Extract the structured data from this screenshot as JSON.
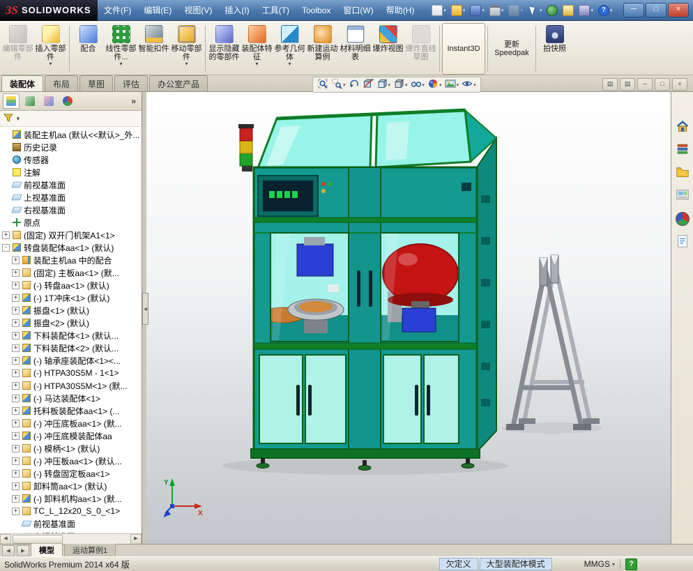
{
  "colors": {
    "status-blue": "#cfe0f2",
    "machine-teal": "#149a91",
    "machine-glass": "#a4f2ea",
    "machine-roof": "#97f4e8",
    "frame-green": "#0f7e28",
    "dome-red": "#c41414",
    "unit-blue": "#2b3fd4",
    "disc-orange": "#c87a2e",
    "stand-gray": "#868c92"
  },
  "titlebar": {
    "logo_mark": "3S",
    "logo_text": "SOLIDWORKS",
    "menus": [
      "文件(F)",
      "编辑(E)",
      "视图(V)",
      "插入(I)",
      "工具(T)",
      "Toolbox",
      "窗口(W)",
      "帮助(H)"
    ],
    "quick_icons": [
      {
        "name": "new-document",
        "dropdown": true
      },
      {
        "name": "open",
        "dropdown": true
      },
      {
        "name": "save",
        "dropdown": true
      },
      {
        "name": "print",
        "dropdown": true
      },
      {
        "name": "undo",
        "dropdown": true,
        "disabled": true
      },
      {
        "name": "select",
        "dropdown": true
      },
      {
        "name": "rebuild",
        "dropdown": false
      },
      {
        "name": "file-properties",
        "dropdown": false
      },
      {
        "name": "options",
        "dropdown": true
      },
      {
        "name": "help",
        "dropdown": true,
        "glyph": "?"
      }
    ],
    "window_controls": [
      {
        "name": "minimize",
        "glyph": "─"
      },
      {
        "name": "maximize",
        "glyph": "□"
      },
      {
        "name": "close",
        "glyph": "×"
      }
    ]
  },
  "ribbon": {
    "buttons": [
      {
        "label": "编辑零部件",
        "icon": "edit-component",
        "disabled": true
      },
      {
        "label": "插入零部件",
        "icon": "insert-components",
        "dropdown": true,
        "group_end": true
      },
      {
        "label": "配合",
        "icon": "mate"
      },
      {
        "label": "线性零部件...",
        "icon": "linear-component-pattern",
        "dropdown": true
      },
      {
        "label": "智能扣件",
        "icon": "smart-fasteners"
      },
      {
        "label": "移动零部件",
        "icon": "move-component",
        "dropdown": true,
        "group_end": true
      },
      {
        "label": "显示隐藏的零部件",
        "icon": "show-hidden-components"
      },
      {
        "label": "装配体特征",
        "icon": "assembly-features",
        "dropdown": true
      },
      {
        "label": "参考几何体",
        "icon": "reference-geometry",
        "dropdown": true
      },
      {
        "label": "新建运动算例",
        "icon": "new-motion-study"
      },
      {
        "label": "材料明细表",
        "icon": "bill-of-materials"
      },
      {
        "label": "爆炸视图",
        "icon": "exploded-view"
      },
      {
        "label": "爆炸直线草图",
        "icon": "explode-line-sketch",
        "disabled": true,
        "group_end": true
      },
      {
        "label": "Instant3D",
        "active": true,
        "group_end": true
      },
      {
        "label": "更新Speedpak",
        "group_end": true
      },
      {
        "label": "拍快照",
        "icon": "take-snapshot"
      }
    ]
  },
  "command_tabs": {
    "items": [
      "装配体",
      "布局",
      "草图",
      "评估",
      "办公室产品"
    ],
    "active_index": 0
  },
  "headsup": {
    "buttons": [
      {
        "name": "zoom-fit"
      },
      {
        "name": "zoom-area",
        "dropdown": true
      },
      {
        "name": "previous-view"
      },
      {
        "name": "section-view"
      },
      {
        "name": "view-orientation",
        "dropdown": true
      },
      {
        "name": "display-style",
        "dropdown": true
      },
      {
        "name": "hide-show-items",
        "dropdown": true
      },
      {
        "name": "edit-appearance",
        "dropdown": true
      },
      {
        "name": "apply-scene",
        "dropdown": true
      },
      {
        "name": "view-settings",
        "dropdown": true
      }
    ]
  },
  "doc_controls": [
    {
      "name": "pane-left",
      "glyph": "▤"
    },
    {
      "name": "pane-right",
      "glyph": "▤"
    },
    {
      "name": "doc-minimize",
      "glyph": "─"
    },
    {
      "name": "doc-restore",
      "glyph": "□"
    },
    {
      "name": "doc-close",
      "glyph": "×"
    }
  ],
  "feature_panel": {
    "tabs": [
      {
        "name": "featuremanager-tree"
      },
      {
        "name": "propertymanager"
      },
      {
        "name": "configurationmanager"
      },
      {
        "name": "displaymanager"
      }
    ],
    "overflow_glyph": "»",
    "filter_dropdown_glyph": "▼",
    "collapse_glyph": "◀",
    "scrollbar": {
      "left_glyph": "◀",
      "right_glyph": "▶"
    },
    "items": [
      {
        "label": "装配主机aa (默认<<默认>_外...",
        "icon": "assembly-top",
        "indent": 0
      },
      {
        "label": "历史记录",
        "icon": "history-folder",
        "indent": 0
      },
      {
        "label": "传感器",
        "icon": "sensors-folder",
        "indent": 0
      },
      {
        "label": "注解",
        "icon": "annotations-folder",
        "indent": 0
      },
      {
        "label": "前视基准面",
        "icon": "plane",
        "indent": 0
      },
      {
        "label": "上视基准面",
        "icon": "plane",
        "indent": 0
      },
      {
        "label": "右视基准面",
        "icon": "plane",
        "indent": 0
      },
      {
        "label": "原点",
        "icon": "origin",
        "indent": 0
      },
      {
        "label": "(固定) 双开门机架A1<1>",
        "icon": "part",
        "indent": 0,
        "expand": "plus"
      },
      {
        "label": "转盘装配体aa<1> (默认)",
        "icon": "assembly",
        "indent": 0,
        "expand": "minus"
      },
      {
        "label": "装配主机aa 中的配合",
        "icon": "mates-folder",
        "indent": 1,
        "expand": "plus"
      },
      {
        "label": "(固定) 主板aa<1> (默...",
        "icon": "part",
        "indent": 1,
        "expand": "plus"
      },
      {
        "label": "(-) 转盘aa<1> (默认)",
        "icon": "part",
        "indent": 1,
        "expand": "plus"
      },
      {
        "label": "(-) 1T冲床<1> (默认)",
        "icon": "assembly",
        "indent": 1,
        "expand": "plus"
      },
      {
        "label": "振盘<1> (默认)",
        "icon": "assembly",
        "indent": 1,
        "expand": "plus"
      },
      {
        "label": "振盘<2> (默认)",
        "icon": "assembly",
        "indent": 1,
        "expand": "plus"
      },
      {
        "label": "下料装配体<1> (默认...",
        "icon": "assembly",
        "indent": 1,
        "expand": "plus"
      },
      {
        "label": "下料装配体<2> (默认...",
        "icon": "assembly",
        "indent": 1,
        "expand": "plus"
      },
      {
        "label": "(-) 轴承座装配体<1><...",
        "icon": "assembly",
        "indent": 1,
        "expand": "plus"
      },
      {
        "label": "(-) HTPA30S5M - 1<1>",
        "icon": "part",
        "indent": 1,
        "expand": "plus"
      },
      {
        "label": "(-) HTPA30S5M<1> (默...",
        "icon": "part",
        "indent": 1,
        "expand": "plus"
      },
      {
        "label": "(-) 马达装配体<1>",
        "icon": "assembly",
        "indent": 1,
        "expand": "plus"
      },
      {
        "label": "托料板装配体aa<1> (...",
        "icon": "assembly",
        "indent": 1,
        "expand": "plus"
      },
      {
        "label": "(-) 冲压底板aa<1> (默...",
        "icon": "part",
        "indent": 1,
        "expand": "plus"
      },
      {
        "label": "(-) 冲压底模装配体aa",
        "icon": "assembly",
        "indent": 1,
        "expand": "plus"
      },
      {
        "label": "(-) 模柄<1> (默认)",
        "icon": "part",
        "indent": 1,
        "expand": "plus"
      },
      {
        "label": "(-) 冲压板aa<1> (默认...",
        "icon": "part",
        "indent": 1,
        "expand": "plus"
      },
      {
        "label": "(-) 转盘固定板aa<1>",
        "icon": "part",
        "indent": 1,
        "expand": "plus"
      },
      {
        "label": "卸料筒aa<1> (默认)",
        "icon": "part",
        "indent": 1,
        "expand": "plus"
      },
      {
        "label": "(-) 卸料机构aa<1> (默...",
        "icon": "assembly",
        "indent": 1,
        "expand": "plus"
      },
      {
        "label": "TC_L_12x20_S_0_<1>",
        "icon": "part",
        "indent": 1,
        "expand": "plus"
      },
      {
        "label": "前视基准面",
        "icon": "plane",
        "indent": 1
      },
      {
        "label": "上视基准面",
        "icon": "plane",
        "indent": 1
      }
    ]
  },
  "taskpane": {
    "icons": [
      {
        "name": "solidworks-resources"
      },
      {
        "name": "design-library"
      },
      {
        "name": "file-explorer"
      },
      {
        "name": "view-palette"
      },
      {
        "name": "appearances-scenes"
      },
      {
        "name": "custom-properties"
      }
    ]
  },
  "model_tabs": {
    "nav_glyphs": [
      "◀",
      "▶"
    ],
    "tabs": [
      {
        "label": "模型",
        "active": true
      },
      {
        "label": "运动算例1",
        "active": false
      }
    ]
  },
  "statusbar": {
    "product": "SolidWorks Premium 2014 x64 版",
    "defined_state": "欠定义",
    "mode": "大型装配体模式",
    "units": "MMGS",
    "units_dropdown_glyph": "▾",
    "help_glyph": "?"
  },
  "viewport": {
    "triad": {
      "x_label": "X",
      "y_label": "Y"
    }
  }
}
